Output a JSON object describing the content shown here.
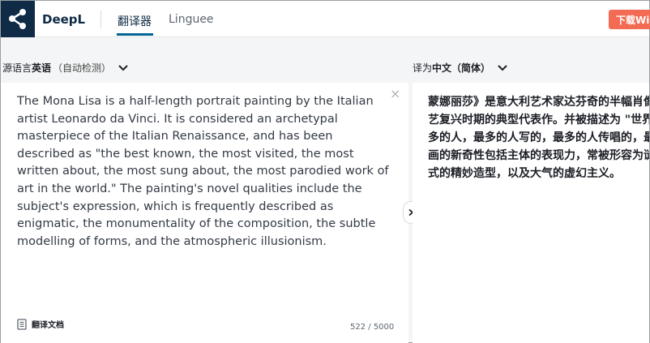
{
  "header": {
    "brand": "DeepL",
    "tabs": [
      {
        "label": "翻译器",
        "active": true
      },
      {
        "label": "Linguee",
        "active": false
      }
    ],
    "download_label": "下载Wi"
  },
  "source_lang": {
    "prefix": "源语言",
    "language": "英语",
    "detect": "（自动检测）"
  },
  "target_lang": {
    "prefix": "译为",
    "language": "中文（简体）"
  },
  "source": {
    "text": "The Mona Lisa is a half-length portrait painting by the Italian artist Leonardo da Vinci. It is considered an archetypal masterpiece of the Italian Renaissance, and has been described as \"the best known, the most visited, the most written about, the most sung about, the most parodied work of art in the world.\" The painting's novel qualities include the subject's expression, which is frequently described as enigmatic, the monumentality of the composition, the subtle modelling of forms, and the atmospheric illusionism.",
    "char_count": "522 / 5000",
    "translate_doc_label": "翻译文档"
  },
  "target": {
    "lines": [
      "蒙娜丽莎》是意大利艺术家达芬奇的半幅肖像",
      "艺复兴时期的典型代表作。并被描述为 \"世界",
      "多的人，最多的人写的，最多的人传唱的，最",
      "画的新奇性包括主体的表现力，常被形容为谜",
      "式的精妙造型，以及大气的虚幻主义。"
    ]
  },
  "colors": {
    "logo_bg": "#0f2b46",
    "accent": "#006494",
    "download_bg": "#f26b52"
  },
  "icons": {
    "logo": "deepl-share-icon",
    "close": "close-icon",
    "chevron": "chevron-down-icon",
    "document": "document-icon",
    "swap": "chevron-right-icon"
  }
}
